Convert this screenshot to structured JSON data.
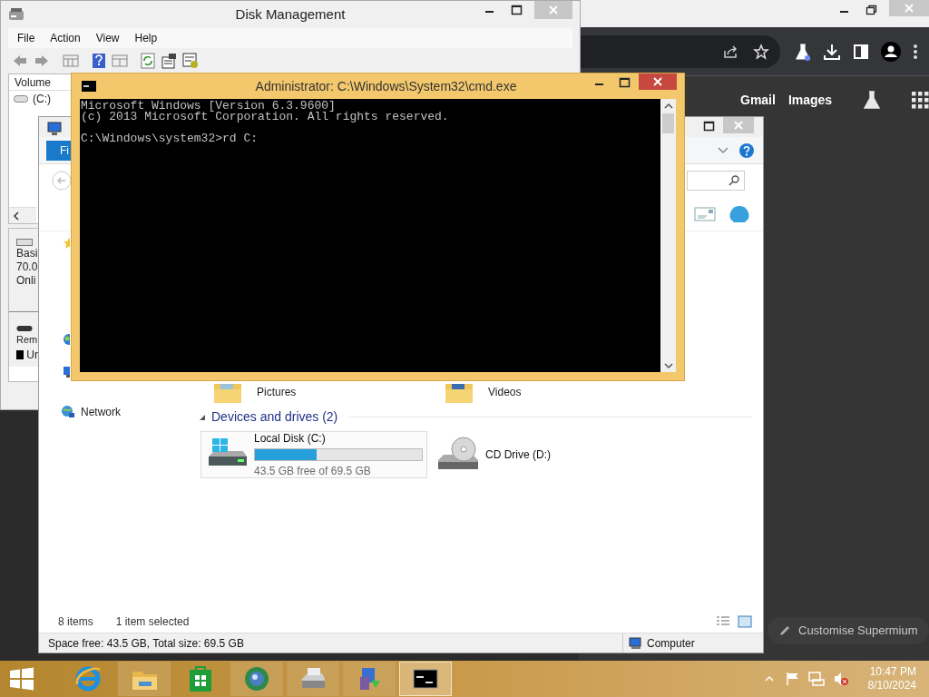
{
  "browser": {
    "links": [
      "Gmail",
      "Images"
    ],
    "customise_button": "Customise Supermium"
  },
  "disk_management": {
    "title": "Disk Management",
    "menu": [
      "File",
      "Action",
      "View",
      "Help"
    ],
    "column": "Volume",
    "volume": "(C:)",
    "disk_labels": [
      "Basi",
      "70.0",
      "Onli"
    ],
    "removable_labels": [
      "Rem",
      "Ur"
    ]
  },
  "explorer": {
    "ribbon_tab": "Fi",
    "nav": [
      "Network"
    ],
    "folders": [
      "Pictures",
      "Videos"
    ],
    "group": "Devices and drives (2)",
    "drives": [
      {
        "kind": "disk",
        "name": "Local Disk (C:)",
        "level": 0.37,
        "free": "43.5 GB free of 69.5 GB"
      },
      {
        "kind": "optical",
        "name": "CD Drive (D:)"
      }
    ],
    "item_count": "8 items",
    "selection": "1 item selected",
    "status": "Space free: 43.5 GB, Total size: 69.5 GB",
    "location": "Computer"
  },
  "console": {
    "title": "Administrator: C:\\Windows\\System32\\cmd.exe",
    "lines": [
      "Microsoft Windows [Version 6.3.9600]",
      "(c) 2013 Microsoft Corporation. All rights reserved."
    ],
    "prompt": "C:\\Windows\\system32>rd C:"
  },
  "taskbar": {
    "apps": [
      {
        "kind": "browser-e",
        "open": false,
        "selected": false
      },
      {
        "kind": "folder",
        "open": true,
        "selected": false
      },
      {
        "kind": "store",
        "open": false,
        "selected": false
      },
      {
        "kind": "globe",
        "open": true,
        "selected": false
      },
      {
        "kind": "printer",
        "open": true,
        "selected": false
      },
      {
        "kind": "installer",
        "open": true,
        "selected": false
      },
      {
        "kind": "console",
        "open": true,
        "selected": true
      }
    ],
    "time": "10:47 PM",
    "date": "8/10/2024"
  }
}
